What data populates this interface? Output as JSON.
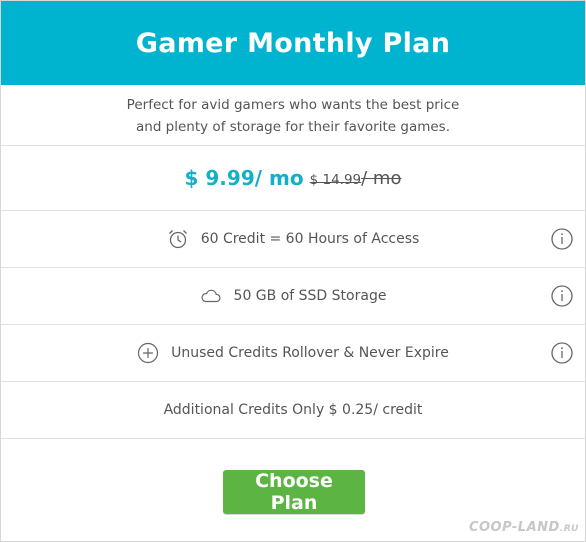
{
  "plan": {
    "title": "Gamer Monthly Plan",
    "description_line1": "Perfect for avid gamers who wants the best price",
    "description_line2": "and plenty of storage for their favorite games.",
    "price_current": "$ 9.99/ mo",
    "price_old_amount": "$ 14.99",
    "price_old_suffix": "/ mo"
  },
  "features": [
    {
      "label": "60 Credit = 60 Hours of Access",
      "icon": "alarm-clock-icon",
      "has_info": true
    },
    {
      "label": "50 GB of SSD Storage",
      "icon": "cloud-icon",
      "has_info": true
    },
    {
      "label": "Unused Credits Rollover & Never Expire",
      "icon": "plus-circle-icon",
      "has_info": true
    },
    {
      "label": "Additional Credits Only $ 0.25/ credit",
      "icon": "",
      "has_info": false
    }
  ],
  "cta": {
    "label": "Choose Plan"
  },
  "watermark": {
    "text": "COOP-LAND",
    "suffix": ".RU"
  },
  "colors": {
    "header": "#00b4cf",
    "price_accent": "#14afc8",
    "button": "#5cb542",
    "border": "#e2e2e2"
  }
}
